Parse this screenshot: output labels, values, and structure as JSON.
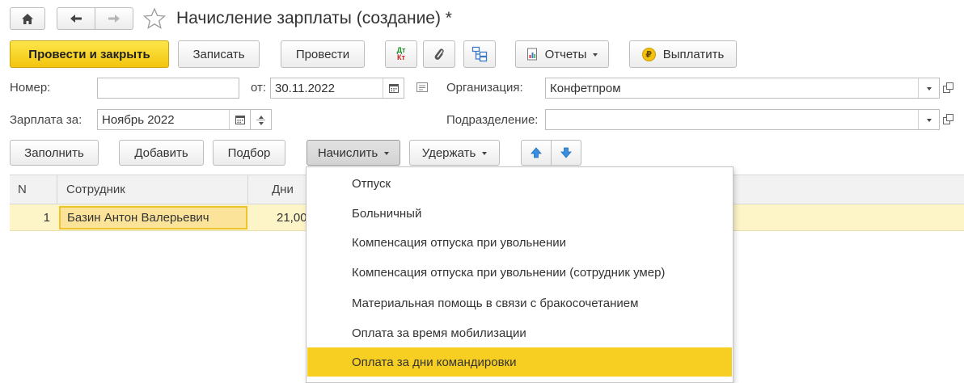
{
  "window": {
    "title": "Начисление зарплаты (создание) *"
  },
  "toolbar": {
    "post_close": "Провести и закрыть",
    "save": "Записать",
    "post": "Провести",
    "dt": "Дт",
    "kt": "Кт",
    "reports": "Отчеты",
    "pay": "Выплатить",
    "pay_symbol": "₽"
  },
  "form": {
    "number_label": "Номер:",
    "number_value": "",
    "date_label": "от:",
    "date_value": "30.11.2022",
    "org_label": "Организация:",
    "org_value": "Конфетпром",
    "salary_label": "Зарплата за:",
    "salary_value": "Ноябрь 2022",
    "dept_label": "Подразделение:",
    "dept_value": ""
  },
  "table_toolbar": {
    "fill": "Заполнить",
    "add": "Добавить",
    "pick": "Подбор",
    "accrue": "Начислить",
    "deduct": "Удержать"
  },
  "table": {
    "columns": [
      "N",
      "Сотрудник",
      "Дни"
    ],
    "rows": [
      {
        "n": "1",
        "employee": "Базин Антон Валерьевич",
        "days": "21,00"
      }
    ]
  },
  "accrue_menu": {
    "items": [
      "Отпуск",
      "Больничный",
      "Компенсация отпуска при увольнении",
      "Компенсация отпуска при увольнении (сотрудник умер)",
      "Материальная помощь в связи с бракосочетанием",
      "Оплата за время мобилизации",
      "Оплата за дни командировки"
    ],
    "selected_index": 6
  }
}
